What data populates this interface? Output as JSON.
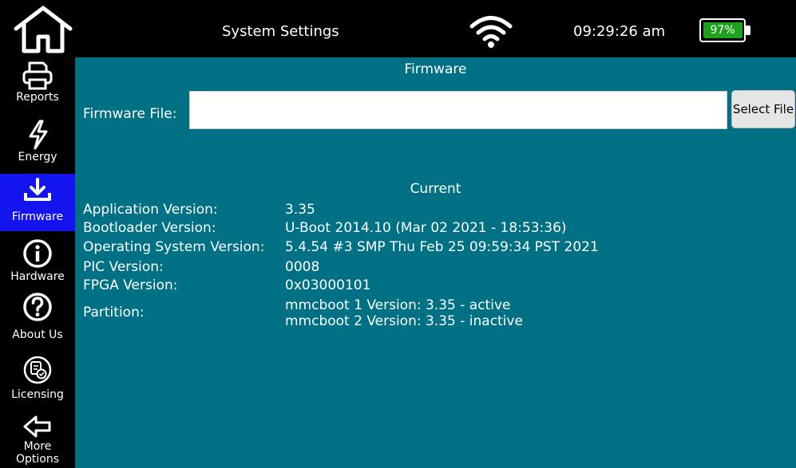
{
  "topbar": {
    "title": "System Settings",
    "time": "09:29:26 am",
    "battery_text": "97%",
    "battery_level": 0.97,
    "battery_color": "#1ea21e",
    "icons": [
      "home-icon",
      "wifi-icon",
      "battery-icon"
    ]
  },
  "sidebar": {
    "active_color": "#1414ee",
    "items": [
      {
        "label": "Reports",
        "icon": "printer-icon"
      },
      {
        "label": "Energy",
        "icon": "lightning-icon"
      },
      {
        "label": "Firmware",
        "icon": "download-icon",
        "active": true
      },
      {
        "label": "Hardware",
        "icon": "info-icon"
      },
      {
        "label": "About Us",
        "icon": "question-icon"
      },
      {
        "label": "Licensing",
        "icon": "license-icon"
      },
      {
        "label": "More",
        "label2": "Options",
        "icon": "arrow-left-icon"
      }
    ]
  },
  "main": {
    "background": "#007185",
    "heading": "Firmware",
    "file_label": "Firmware File:",
    "file_value": "",
    "select_button": "Select File",
    "current_heading": "Current",
    "info": [
      {
        "label": "Application Version:",
        "value": "3.35"
      },
      {
        "label": "Bootloader Version:",
        "value": "U-Boot 2014.10 (Mar 02 2021 - 18:53:36)"
      },
      {
        "label": "Operating System Version:",
        "value": "5.4.54 #3 SMP Thu Feb 25 09:59:34 PST 2021"
      },
      {
        "label": "PIC Version:",
        "value": "0008"
      },
      {
        "label": "FPGA Version:",
        "value": "0x03000101"
      }
    ],
    "partition": {
      "label": "Partition:",
      "values": [
        "mmcboot 1 Version:  3.35 - active",
        "mmcboot 2 Version:  3.35 - inactive"
      ]
    }
  }
}
